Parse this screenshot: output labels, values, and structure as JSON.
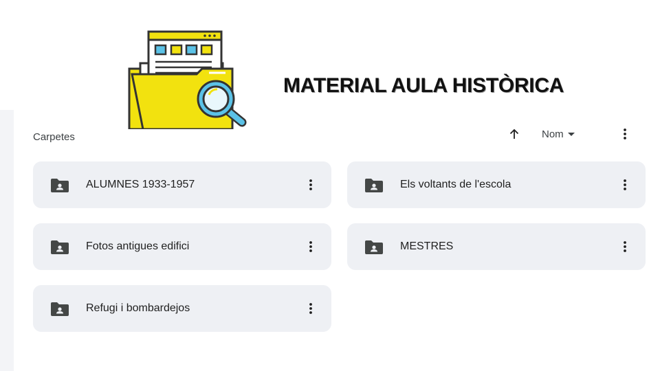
{
  "header": {
    "title": "MATERIAL AULA HISTÒRICA",
    "logo_icon": "folder-magnifier-illustration-icon"
  },
  "section": {
    "label": "Carpetes"
  },
  "toolbar": {
    "sort_direction_icon": "arrow-up-icon",
    "sort_field_label": "Nom",
    "sort_dropdown_icon": "caret-down-icon",
    "more_icon": "more-vert-icon"
  },
  "folders": [
    {
      "name": "ALUMNES 1933-1957",
      "icon": "shared-folder-icon"
    },
    {
      "name": "Els voltants de l'escola",
      "icon": "shared-folder-icon"
    },
    {
      "name": "Fotos antigues edifici",
      "icon": "shared-folder-icon"
    },
    {
      "name": "MESTRES",
      "icon": "shared-folder-icon"
    },
    {
      "name": "Refugi i bombardejos",
      "icon": "shared-folder-icon"
    }
  ],
  "colors": {
    "card_background": "#eef0f4",
    "icon_dark": "#444746",
    "logo_yellow": "#f2e20f",
    "logo_blue": "#5bc2e7"
  }
}
